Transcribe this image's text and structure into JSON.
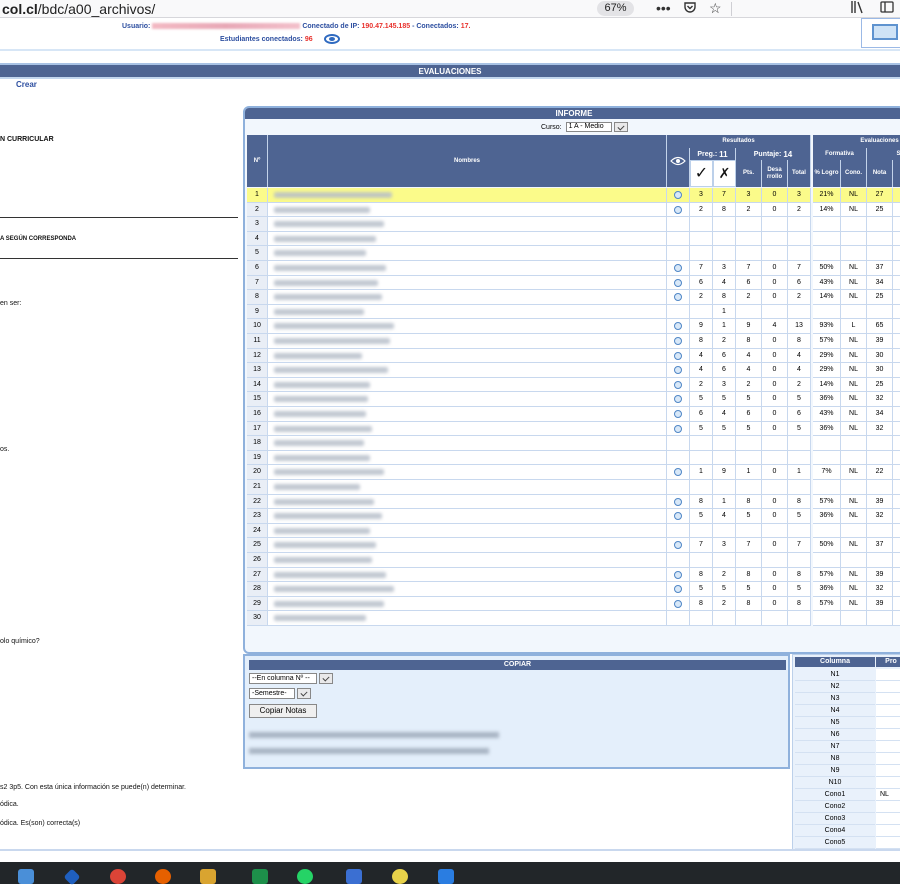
{
  "browser": {
    "url_domain": "col.cl",
    "url_path": "/bdc/a00_archivos/",
    "zoom": "67%"
  },
  "header": {
    "usuario_label": "Usuario:",
    "ip_label": "Conectado de IP:",
    "ip_value": "190.47.145.185",
    "conectados_label": "- Conectados:",
    "conectados_value": "17.",
    "estudiantes_label": "Estudiantes conectados:",
    "estudiantes_value": "96"
  },
  "nav": {
    "section_title": "EVALUACIONES",
    "crear_label": "Crear"
  },
  "left": {
    "curricular": "N CURRICULAR",
    "segun": "A SEGÚN CORRESPONDA",
    "en_ser": "en ser:",
    "os": "os.",
    "quimico": "olo químico?",
    "bottom1": "s2 3p5. Con esta única información se puede(n) determinar.",
    "bottom2": "ódica.",
    "bottom3": "ódica. Es(son) correcta(s)"
  },
  "informe": {
    "title": "INFORME",
    "curso_label": "Curso:",
    "curso_value": "1 A - Medio",
    "headers": {
      "num": "Nº",
      "nombres": "Nombres",
      "resultados": "Resultados",
      "evaluaciones": "Evaluaciones",
      "preg_label": "Preg.:",
      "preg_value": "11",
      "puntaje_label": "Puntaje:",
      "puntaje_value": "14",
      "pts": "Pts.",
      "desarrollo": "Desa rrollo",
      "total": "Total",
      "formativa": "Formativa",
      "sumativa": "Sumati",
      "pct_logro": "% Logro",
      "cono": "Cono.",
      "nota": "Nota",
      "check_glyph": "✓",
      "cross_glyph": "✗",
      "eye_glyph": "◉"
    },
    "rows": [
      {
        "n": "1",
        "eye": true,
        "c": "3",
        "x": "7",
        "pts": "3",
        "des": "0",
        "tot": "3",
        "pct": "21%",
        "cono": "NL",
        "nota": "27",
        "hl": true
      },
      {
        "n": "2",
        "eye": true,
        "c": "2",
        "x": "8",
        "pts": "2",
        "des": "0",
        "tot": "2",
        "pct": "14%",
        "cono": "NL",
        "nota": "25"
      },
      {
        "n": "3",
        "eye": false,
        "c": "",
        "x": "",
        "pts": "",
        "des": "",
        "tot": "",
        "pct": "",
        "cono": "",
        "nota": ""
      },
      {
        "n": "4",
        "eye": false,
        "c": "",
        "x": "",
        "pts": "",
        "des": "",
        "tot": "",
        "pct": "",
        "cono": "",
        "nota": ""
      },
      {
        "n": "5",
        "eye": false,
        "c": "",
        "x": "",
        "pts": "",
        "des": "",
        "tot": "",
        "pct": "",
        "cono": "",
        "nota": ""
      },
      {
        "n": "6",
        "eye": true,
        "c": "7",
        "x": "3",
        "pts": "7",
        "des": "0",
        "tot": "7",
        "pct": "50%",
        "cono": "NL",
        "nota": "37"
      },
      {
        "n": "7",
        "eye": true,
        "c": "6",
        "x": "4",
        "pts": "6",
        "des": "0",
        "tot": "6",
        "pct": "43%",
        "cono": "NL",
        "nota": "34"
      },
      {
        "n": "8",
        "eye": true,
        "c": "2",
        "x": "8",
        "pts": "2",
        "des": "0",
        "tot": "2",
        "pct": "14%",
        "cono": "NL",
        "nota": "25"
      },
      {
        "n": "9",
        "eye": false,
        "c": "",
        "x": "1",
        "pts": "",
        "des": "",
        "tot": "",
        "pct": "",
        "cono": "",
        "nota": ""
      },
      {
        "n": "10",
        "eye": true,
        "c": "9",
        "x": "1",
        "pts": "9",
        "des": "4",
        "tot": "13",
        "pct": "93%",
        "cono": "L",
        "nota": "65"
      },
      {
        "n": "11",
        "eye": true,
        "c": "8",
        "x": "2",
        "pts": "8",
        "des": "0",
        "tot": "8",
        "pct": "57%",
        "cono": "NL",
        "nota": "39"
      },
      {
        "n": "12",
        "eye": true,
        "c": "4",
        "x": "6",
        "pts": "4",
        "des": "0",
        "tot": "4",
        "pct": "29%",
        "cono": "NL",
        "nota": "30"
      },
      {
        "n": "13",
        "eye": true,
        "c": "4",
        "x": "6",
        "pts": "4",
        "des": "0",
        "tot": "4",
        "pct": "29%",
        "cono": "NL",
        "nota": "30"
      },
      {
        "n": "14",
        "eye": true,
        "c": "2",
        "x": "3",
        "pts": "2",
        "des": "0",
        "tot": "2",
        "pct": "14%",
        "cono": "NL",
        "nota": "25"
      },
      {
        "n": "15",
        "eye": true,
        "c": "5",
        "x": "5",
        "pts": "5",
        "des": "0",
        "tot": "5",
        "pct": "36%",
        "cono": "NL",
        "nota": "32"
      },
      {
        "n": "16",
        "eye": true,
        "c": "6",
        "x": "4",
        "pts": "6",
        "des": "0",
        "tot": "6",
        "pct": "43%",
        "cono": "NL",
        "nota": "34"
      },
      {
        "n": "17",
        "eye": true,
        "c": "5",
        "x": "5",
        "pts": "5",
        "des": "0",
        "tot": "5",
        "pct": "36%",
        "cono": "NL",
        "nota": "32"
      },
      {
        "n": "18",
        "eye": false,
        "c": "",
        "x": "",
        "pts": "",
        "des": "",
        "tot": "",
        "pct": "",
        "cono": "",
        "nota": ""
      },
      {
        "n": "19",
        "eye": false,
        "c": "",
        "x": "",
        "pts": "",
        "des": "",
        "tot": "",
        "pct": "",
        "cono": "",
        "nota": ""
      },
      {
        "n": "20",
        "eye": true,
        "c": "1",
        "x": "9",
        "pts": "1",
        "des": "0",
        "tot": "1",
        "pct": "7%",
        "cono": "NL",
        "nota": "22"
      },
      {
        "n": "21",
        "eye": false,
        "c": "",
        "x": "",
        "pts": "",
        "des": "",
        "tot": "",
        "pct": "",
        "cono": "",
        "nota": ""
      },
      {
        "n": "22",
        "eye": true,
        "c": "8",
        "x": "1",
        "pts": "8",
        "des": "0",
        "tot": "8",
        "pct": "57%",
        "cono": "NL",
        "nota": "39"
      },
      {
        "n": "23",
        "eye": true,
        "c": "5",
        "x": "4",
        "pts": "5",
        "des": "0",
        "tot": "5",
        "pct": "36%",
        "cono": "NL",
        "nota": "32"
      },
      {
        "n": "24",
        "eye": false,
        "c": "",
        "x": "",
        "pts": "",
        "des": "",
        "tot": "",
        "pct": "",
        "cono": "",
        "nota": ""
      },
      {
        "n": "25",
        "eye": true,
        "c": "7",
        "x": "3",
        "pts": "7",
        "des": "0",
        "tot": "7",
        "pct": "50%",
        "cono": "NL",
        "nota": "37"
      },
      {
        "n": "26",
        "eye": false,
        "c": "",
        "x": "",
        "pts": "",
        "des": "",
        "tot": "",
        "pct": "",
        "cono": "",
        "nota": ""
      },
      {
        "n": "27",
        "eye": true,
        "c": "8",
        "x": "2",
        "pts": "8",
        "des": "0",
        "tot": "8",
        "pct": "57%",
        "cono": "NL",
        "nota": "39"
      },
      {
        "n": "28",
        "eye": true,
        "c": "5",
        "x": "5",
        "pts": "5",
        "des": "0",
        "tot": "5",
        "pct": "36%",
        "cono": "NL",
        "nota": "32"
      },
      {
        "n": "29",
        "eye": true,
        "c": "8",
        "x": "2",
        "pts": "8",
        "des": "0",
        "tot": "8",
        "pct": "57%",
        "cono": "NL",
        "nota": "39"
      },
      {
        "n": "30",
        "eye": false,
        "c": "",
        "x": "",
        "pts": "",
        "des": "",
        "tot": "",
        "pct": "",
        "cono": "",
        "nota": ""
      }
    ]
  },
  "copiar": {
    "title": "COPIAR",
    "columna_select": "--En columna Nº --",
    "semestre_select": "-Semestre-",
    "button": "Copiar Notas"
  },
  "columna": {
    "header": "Columna",
    "header2": "Pro",
    "items": [
      "N1",
      "N2",
      "N3",
      "N4",
      "N5",
      "N6",
      "N7",
      "N8",
      "N9",
      "N10",
      "Cono1",
      "Cono2",
      "Cono3",
      "Cono4",
      "Cono5"
    ],
    "cono1_value": "NL"
  },
  "colors": {
    "header_blue": "#4e6492",
    "highlight_yellow": "#fbfb8a",
    "link_blue": "#2d4fa0",
    "alert_red": "#e8322d"
  }
}
